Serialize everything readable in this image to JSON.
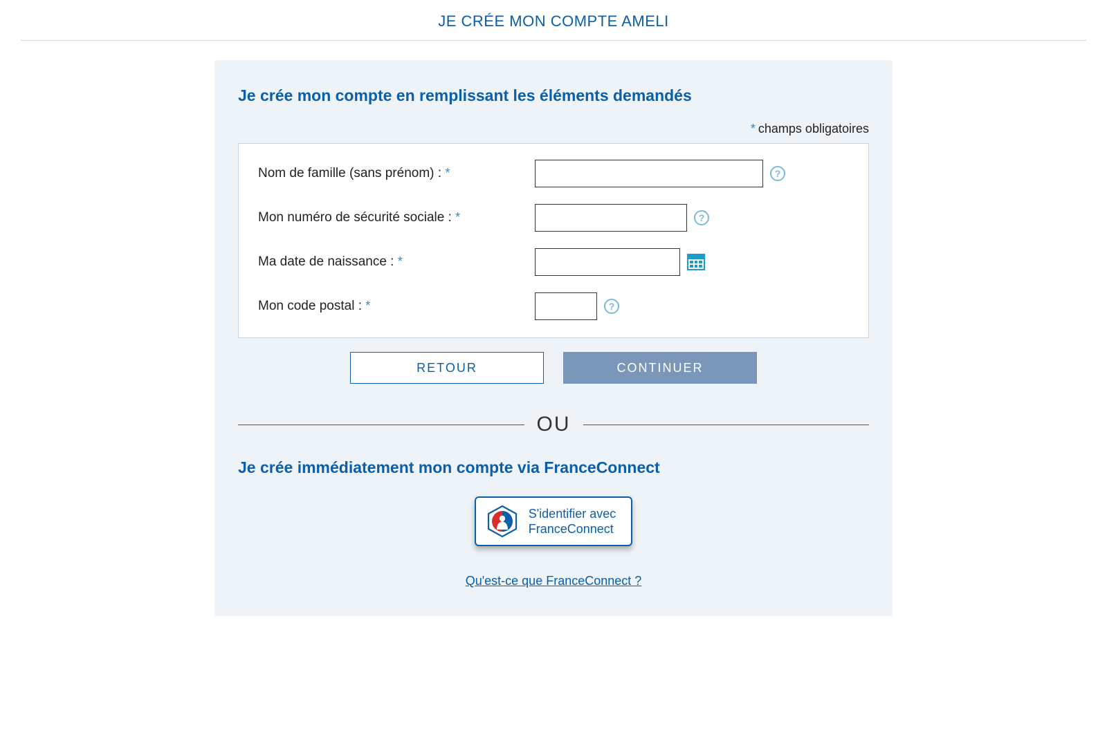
{
  "page": {
    "title": "JE CRÉE MON COMPTE AMELI"
  },
  "form_section": {
    "heading": "Je crée mon compte en remplissant les éléments demandés",
    "required_marker": "*",
    "required_note": "champs obligatoires",
    "fields": {
      "lastname": {
        "label": "Nom de famille (sans prénom) :",
        "value": ""
      },
      "ssn": {
        "label": "Mon numéro de sécurité sociale :",
        "value": ""
      },
      "dob": {
        "label": "Ma date de naissance :",
        "value": ""
      },
      "zip": {
        "label": "Mon code postal :",
        "value": ""
      }
    },
    "buttons": {
      "back": "RETOUR",
      "continue": "CONTINUER"
    }
  },
  "divider": {
    "text": "OU"
  },
  "franceconnect": {
    "heading": "Je crée immédiatement mon compte via FranceConnect",
    "button_line1": "S'identifier avec",
    "button_line2": "FranceConnect",
    "link": "Qu'est-ce que FranceConnect ?"
  },
  "icons": {
    "help_glyph": "?"
  }
}
